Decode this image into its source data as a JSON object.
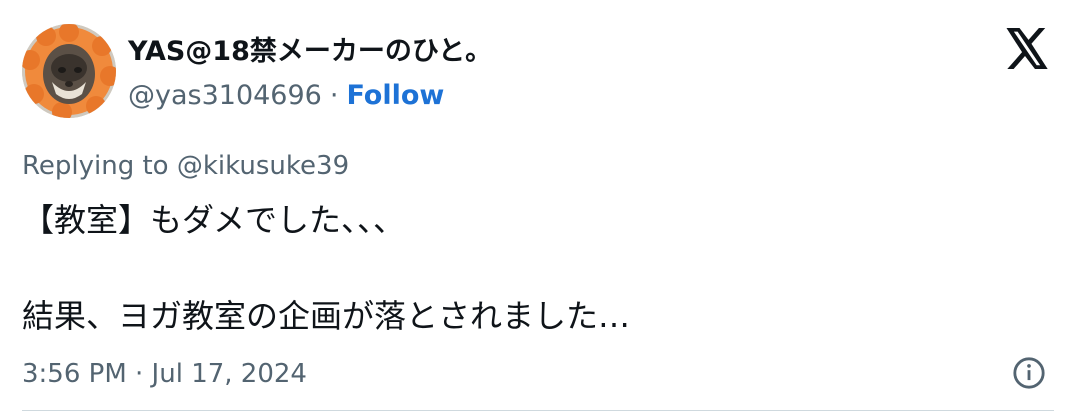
{
  "author": {
    "display_name": "YAS@18禁メーカーのひと。",
    "handle": "@yas3104696",
    "separator": "·",
    "follow_label": "Follow"
  },
  "reply": {
    "prefix": "Replying to",
    "mention": "@kikusuke39"
  },
  "tweet": {
    "line1": "【教室】もダメでした、、、",
    "line2": "結果、ヨガ教室の企画が落とされました…"
  },
  "meta": {
    "timestamp": "3:56 PM · Jul 17, 2024"
  },
  "icons": {
    "platform": "x-logo-icon",
    "info": "info-icon"
  },
  "colors": {
    "link": "#1d72d6",
    "secondary_text": "#536471",
    "primary_text": "#0f1419"
  }
}
